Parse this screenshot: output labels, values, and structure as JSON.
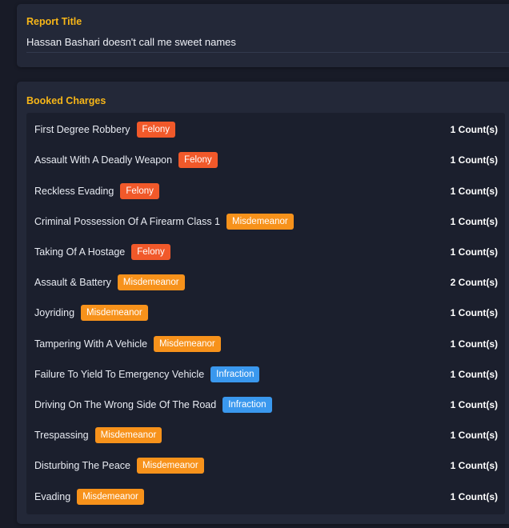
{
  "report": {
    "title_label": "Report Title",
    "title_value": "Hassan Bashari doesn't call me sweet names"
  },
  "charges": {
    "label": "Booked Charges",
    "items": [
      {
        "name": "First Degree Robbery",
        "type": "Felony",
        "count": "1 Count(s)"
      },
      {
        "name": "Assault With A Deadly Weapon",
        "type": "Felony",
        "count": "1 Count(s)"
      },
      {
        "name": "Reckless Evading",
        "type": "Felony",
        "count": "1 Count(s)"
      },
      {
        "name": "Criminal Possession Of A Firearm Class 1",
        "type": "Misdemeanor",
        "count": "1 Count(s)"
      },
      {
        "name": "Taking Of A Hostage",
        "type": "Felony",
        "count": "1 Count(s)"
      },
      {
        "name": "Assault & Battery",
        "type": "Misdemeanor",
        "count": "2 Count(s)"
      },
      {
        "name": "Joyriding",
        "type": "Misdemeanor",
        "count": "1 Count(s)"
      },
      {
        "name": "Tampering With A Vehicle",
        "type": "Misdemeanor",
        "count": "1 Count(s)"
      },
      {
        "name": "Failure To Yield To Emergency Vehicle",
        "type": "Infraction",
        "count": "1 Count(s)"
      },
      {
        "name": "Driving On The Wrong Side Of The Road",
        "type": "Infraction",
        "count": "1 Count(s)"
      },
      {
        "name": "Trespassing",
        "type": "Misdemeanor",
        "count": "1 Count(s)"
      },
      {
        "name": "Disturbing The Peace",
        "type": "Misdemeanor",
        "count": "1 Count(s)"
      },
      {
        "name": "Evading",
        "type": "Misdemeanor",
        "count": "1 Count(s)"
      }
    ]
  },
  "colors": {
    "accent": "#f7b618",
    "felony": "#f1592a",
    "misdemeanor": "#f7921b",
    "infraction": "#3a98ee"
  }
}
